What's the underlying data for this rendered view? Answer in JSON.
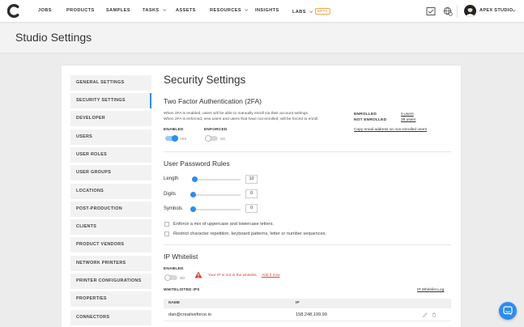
{
  "nav": {
    "items": [
      "JOBS",
      "PRODUCTS",
      "SAMPLES",
      "TASKS",
      "ASSETS",
      "RESOURCES",
      "INSIGHTS",
      "LABS"
    ],
    "beta_badge": "BETA",
    "studio_name": "APEX STUDIO"
  },
  "page": {
    "title": "Studio Settings"
  },
  "sidebar": {
    "items": [
      {
        "label": "GENERAL SETTINGS"
      },
      {
        "label": "SECURITY SETTINGS"
      },
      {
        "label": "DEVELOPER"
      },
      {
        "label": "USERS"
      },
      {
        "label": "USER ROLES"
      },
      {
        "label": "USER GROUPS"
      },
      {
        "label": "LOCATIONS"
      },
      {
        "label": "POST-PRODUCTION"
      },
      {
        "label": "CLIENTS"
      },
      {
        "label": "PRODUCT VENDORS"
      },
      {
        "label": "NETWORK PRINTERS"
      },
      {
        "label": "PRINTER CONFIGURATIONS"
      },
      {
        "label": "PROPERTIES"
      },
      {
        "label": "CONNECTORS"
      }
    ],
    "active": "SECURITY SETTINGS"
  },
  "security": {
    "title": "Security Settings",
    "twofa": {
      "title": "Two Factor Authentication (2FA)",
      "desc1": "When 2FA is enabled, users will be able to manually enroll via their account settings.",
      "desc2": "When 2FA is enforced, new users and users that have not enrolled, will be forced to enroll.",
      "enabled_label": "ENABLED",
      "enabled_state": "YES",
      "enforced_label": "ENFORCED",
      "enforced_state": "NO",
      "enrolled_label": "ENROLLED",
      "enrolled_value": "0 users",
      "not_enrolled_label": "NOT ENROLLED",
      "not_enrolled_value": "28 users",
      "copy_link": "Copy email address on non-enrolled users"
    },
    "password": {
      "title": "User Password Rules",
      "rules": [
        {
          "label": "Length",
          "value": "10"
        },
        {
          "label": "Digits",
          "value": "0"
        },
        {
          "label": "Symbols",
          "value": "0"
        }
      ],
      "options": [
        "Enforce a mix of uppercase and lowercase letters.",
        "Restrict character repetition, keyboard patterns, letter or number sequences."
      ]
    },
    "whitelist": {
      "title": "IP Whitelist",
      "enabled_label": "ENABLED",
      "enabled_state": "NO",
      "warning": "Your IP is not in the whitelist.",
      "warning_link": "Add it now",
      "list_label": "WHITELISTED IPS",
      "log_link": "IP Whitelist Log",
      "columns": [
        "NAME",
        "IP"
      ],
      "rows": [
        {
          "name": "dan@creativeforce.io",
          "ip": "158.248.199.99"
        }
      ]
    }
  },
  "colors": {
    "accent": "#2d8cf0",
    "warning": "#d9443b",
    "beta": "#f1a64a"
  }
}
